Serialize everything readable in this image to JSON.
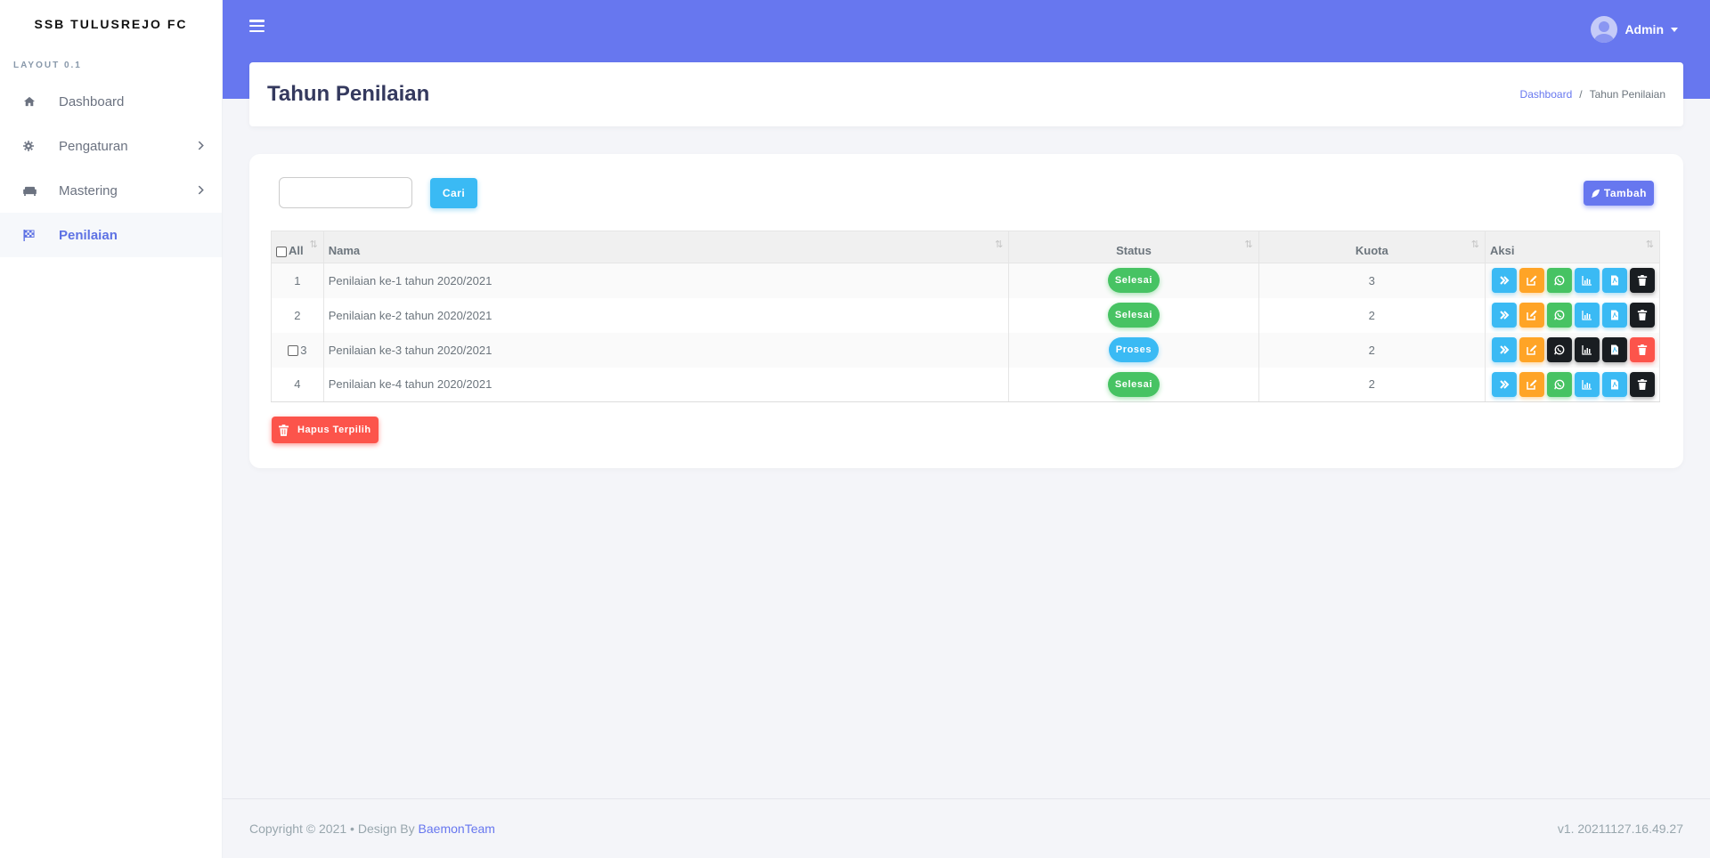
{
  "sidebar": {
    "brand": "SSB TULUSREJO FC",
    "section_label": "LAYOUT 0.1",
    "items": [
      {
        "label": "Dashboard",
        "icon": "home-icon",
        "has_submenu": false,
        "active": false
      },
      {
        "label": "Pengaturan",
        "icon": "gear-icon",
        "has_submenu": true,
        "active": false
      },
      {
        "label": "Mastering",
        "icon": "couch-icon",
        "has_submenu": true,
        "active": false
      },
      {
        "label": "Penilaian",
        "icon": "flag-checkered-icon",
        "has_submenu": false,
        "active": true
      }
    ]
  },
  "header": {
    "user_name": "Admin"
  },
  "page": {
    "title": "Tahun Penilaian",
    "breadcrumb": [
      "Dashboard",
      "Tahun Penilaian"
    ]
  },
  "toolbar": {
    "search_value": "",
    "search_label": "Cari",
    "add_label": "Tambah"
  },
  "table": {
    "columns": [
      "All",
      "Nama",
      "Status",
      "Kuota",
      "Aksi"
    ],
    "rows": [
      {
        "no": "1",
        "nama": "Penilaian ke-1 tahun 2020/2021",
        "status": "Selesai",
        "kuota": "3",
        "checkbox": false
      },
      {
        "no": "2",
        "nama": "Penilaian ke-2 tahun 2020/2021",
        "status": "Selesai",
        "kuota": "2",
        "checkbox": false
      },
      {
        "no": "3",
        "nama": "Penilaian ke-3 tahun 2020/2021",
        "status": "Proses",
        "kuota": "2",
        "checkbox": true
      },
      {
        "no": "4",
        "nama": "Penilaian ke-4 tahun 2020/2021",
        "status": "Selesai",
        "kuota": "2",
        "checkbox": false
      }
    ]
  },
  "bulk": {
    "delete_label": "Hapus Terpilih"
  },
  "footer": {
    "copyright": "Copyright © 2021  •  Design By ",
    "designer": "BaemonTeam",
    "version": "v1. 20211127.16.49.27"
  },
  "colors": {
    "primary": "#6777ef",
    "info": "#3abaf4",
    "success": "#47c363",
    "warning": "#ffa426",
    "danger": "#fc544b",
    "dark": "#191d21"
  }
}
